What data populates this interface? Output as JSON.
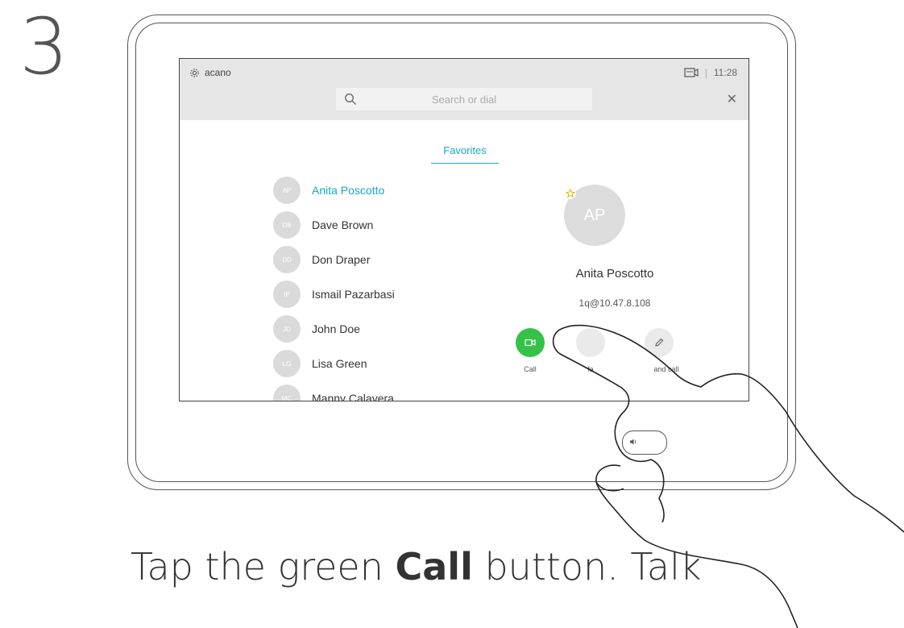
{
  "step": "3",
  "topbar": {
    "brand": "acano",
    "time": "11:28",
    "separator": "|"
  },
  "search": {
    "placeholder": "Search or dial"
  },
  "tabs": [
    {
      "label": "Favorites"
    }
  ],
  "contacts": [
    {
      "initials": "AP",
      "name": "Anita Poscotto"
    },
    {
      "initials": "DB",
      "name": "Dave Brown"
    },
    {
      "initials": "DD",
      "name": "Don Draper"
    },
    {
      "initials": "IP",
      "name": "Ismail Pazarbasi"
    },
    {
      "initials": "JD",
      "name": "John Doe"
    },
    {
      "initials": "LG",
      "name": "Lisa Green"
    },
    {
      "initials": "MC",
      "name": "Manny Calavera"
    }
  ],
  "detail": {
    "initials": "AP",
    "name": "Anita Poscotto",
    "address": "1q@10.47.8.108"
  },
  "actions": [
    {
      "label": "Call"
    },
    {
      "label": "fa"
    },
    {
      "label": "and call"
    }
  ],
  "caption": {
    "line1_pre": "Tap the green ",
    "line1_bold": "Call",
    "line1_post": " button. Talk"
  },
  "colors": {
    "accent": "#17a8c9",
    "call_green": "#35c24a"
  }
}
